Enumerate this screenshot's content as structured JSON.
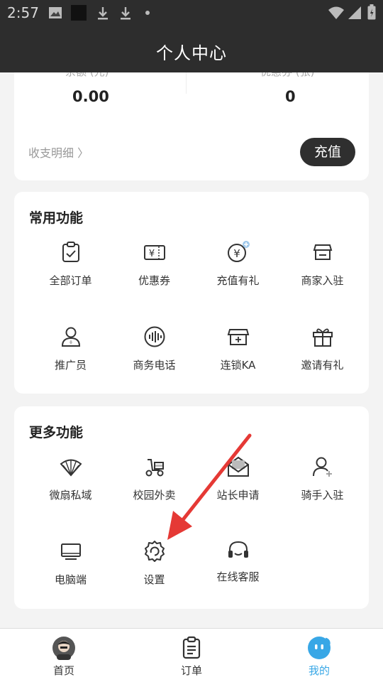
{
  "status_bar": {
    "time": "2:57"
  },
  "header": {
    "title": "个人中心"
  },
  "balance": {
    "balance_label": "余额 (元)",
    "balance_value": "0.00",
    "coupon_label": "优惠券 (张)",
    "coupon_value": "0",
    "details_link": "收支明细 〉",
    "recharge_button": "充值"
  },
  "common_functions": {
    "title": "常用功能",
    "items": [
      {
        "label": "全部订单",
        "icon": "clipboard-check-icon"
      },
      {
        "label": "优惠券",
        "icon": "ticket-yen-icon"
      },
      {
        "label": "充值有礼",
        "icon": "coin-yen-plus-icon"
      },
      {
        "label": "商家入驻",
        "icon": "store-icon"
      },
      {
        "label": "推广员",
        "icon": "person-icon"
      },
      {
        "label": "商务电话",
        "icon": "voice-wave-icon"
      },
      {
        "label": "连锁KA",
        "icon": "chain-store-icon"
      },
      {
        "label": "邀请有礼",
        "icon": "gift-icon"
      }
    ]
  },
  "more_functions": {
    "title": "更多功能",
    "items": [
      {
        "label": "微扇私域",
        "icon": "fan-icon"
      },
      {
        "label": "校园外卖",
        "icon": "scooter-icon"
      },
      {
        "label": "站长申请",
        "icon": "mail-icon"
      },
      {
        "label": "骑手入驻",
        "icon": "person-plus-icon"
      },
      {
        "label": "电脑端",
        "icon": "monitor-icon"
      },
      {
        "label": "设置",
        "icon": "gear-icon"
      },
      {
        "label": "在线客服",
        "icon": "headset-icon"
      }
    ]
  },
  "tab_bar": {
    "tabs": [
      {
        "label": "首页",
        "icon": "avatar-icon",
        "active": false
      },
      {
        "label": "订单",
        "icon": "order-list-icon",
        "active": false
      },
      {
        "label": "我的",
        "icon": "mine-face-icon",
        "active": true
      }
    ]
  },
  "colors": {
    "header_bg": "#2d2d2d",
    "accent_blue": "#38a7e6",
    "arrow_red": "#e53935"
  }
}
